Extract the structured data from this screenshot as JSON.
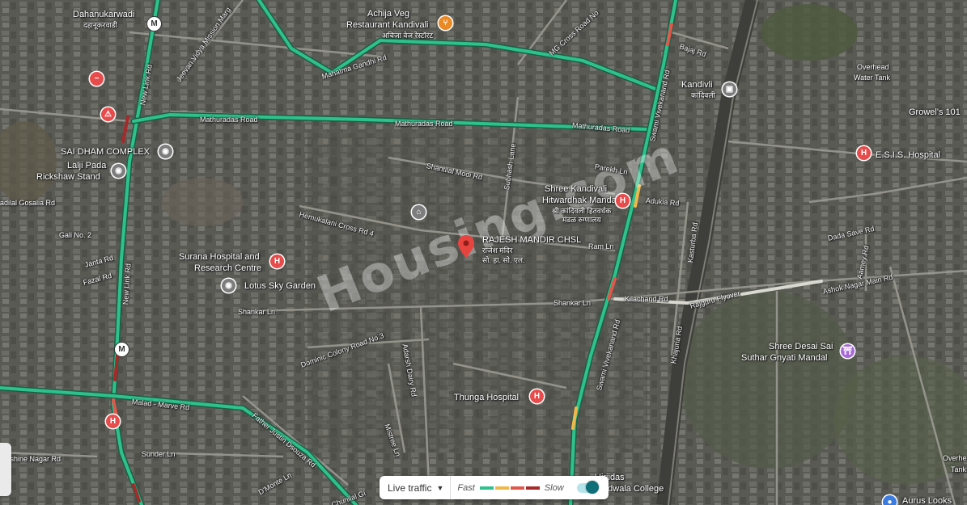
{
  "map": {
    "watermark": "Housing.com",
    "places": {
      "dahanukarwadi": "Dahanukarwadi",
      "dahanukarwadi_local": "दहानूकरवाडी",
      "achija": "Achija Veg",
      "achija2": "Restaurant Kandivali",
      "achija_local": "अचिजा वेज रेस्टॉरंट",
      "kandivli": "Kandivli",
      "kandivli_local": "कांदिवली",
      "overhead": "Overhead",
      "overhead2": "Water Tank",
      "growels": "Growel's 101",
      "esis": "E.S.I.S. Hospital",
      "sai_dham": "SAI DHAM COMPLEX",
      "lalji": "Lalji Pada",
      "lalji2": "Rickshaw Stand",
      "shree_kandivali": "Shree Kandivali",
      "shree_kandivali2": "Hitwardhak Mandal...",
      "shree_kandivali_local": "श्री कांदिवली हितवर्धक",
      "shree_kandivali_local2": "मंडळ रुग्णालय",
      "rajesh": "RAJESH MANDIR CHSL",
      "rajesh_local": "राजेश मंदिर",
      "rajesh_local2": "सो. हा. सो. एल.",
      "surana": "Surana Hospital and",
      "surana2": "Research Centre",
      "lotus": "Lotus Sky Garden",
      "shree_desai": "Shree Desai Sai",
      "shree_desai2": "Suthar Gnyati Mandal",
      "thunga": "Thunga Hospital",
      "hirji": "Hirjidas",
      "hirji2": "Nandwala College",
      "overhead_right": "Overhe",
      "overhead_right2": "Tank",
      "aurus": "Aurus Looks",
      "gali": "Gali No. 2",
      "janta": "Janta Rd",
      "fazal": "Fazal Rd",
      "dadila": "adilal Gosalia Rd",
      "overshine": "vershine Nagar Rd"
    },
    "roads": {
      "mathuradas1": "Mathuradas Road",
      "mathuradas2": "Mathuradas Road",
      "mathuradas3": "Mathuradas Road",
      "mahatma": "Mahatma Gandhi Rd",
      "jeevan": "Jeevan Vidya Mission Marg",
      "mg_cross": "MG Cross Road No",
      "bajaj": "Bajaj Rd",
      "swami1": "Swami Vivekanand Rd",
      "swami2": "Swami Vivekanand Rd",
      "new_link1": "New Link Rd",
      "new_link2": "New Link Rd",
      "shantilal": "Shantilal Modi Rd",
      "subhash": "Subhash Lane",
      "parekh": "Parekh Ln",
      "adukia": "Adukia Rd",
      "kasturba": "Kasturba Rd",
      "dada_save": "Dada Save Rd",
      "aarey": "Aamey Rd",
      "ashok": "Ashok Nagar Main Rd",
      "hemukalani": "Hemukalani Cross Rd 4",
      "ram": "Ram Ln",
      "shankar1": "Shankar Ln",
      "shankar2": "Shankar Ln",
      "kilachand": "Kilachand Rd",
      "rajguru": "Rajguru Flyover",
      "khajuria": "Khajuria Rd",
      "dominic": "Dominic Colony Road No.3",
      "adarsh": "Adarsh Dairy Rd",
      "malad": "Malad - Marve Rd",
      "father": "Father Justin Dsouza Rd",
      "sunder": "Sunder Ln",
      "dmonte": "D'Monte Ln",
      "mistree": "Mistree Ln",
      "chunilal": "Chunilal Gi"
    }
  },
  "traffic_legend": {
    "live_label": "Live traffic",
    "fast": "Fast",
    "slow": "Slow",
    "colors": [
      "#2fc18c",
      "#f0b84a",
      "#e0574c",
      "#a52a2a"
    ],
    "toggle_on": true
  }
}
